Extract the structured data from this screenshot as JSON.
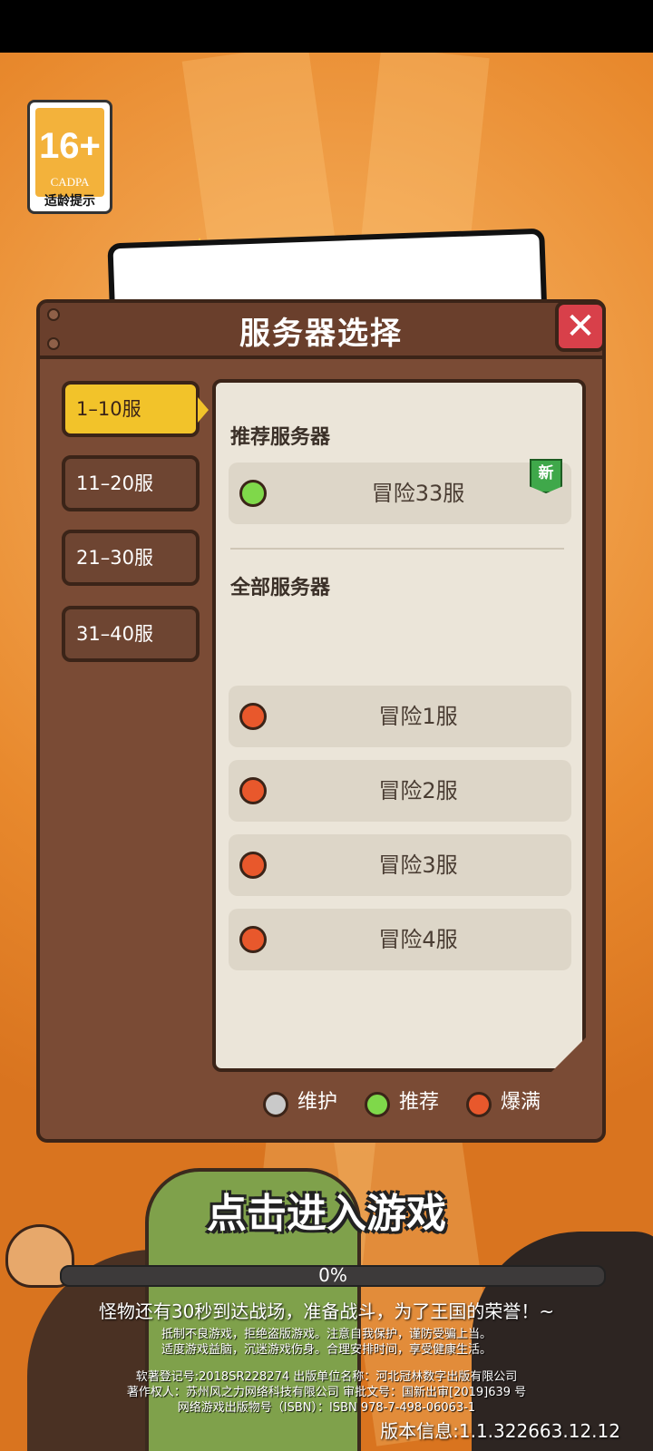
{
  "age_rating": {
    "number": "16+",
    "org": "CADPA",
    "label": "适龄提示"
  },
  "dialog": {
    "title": "服务器选择",
    "close_icon": "close-icon"
  },
  "tabs": [
    {
      "label": "1–10服",
      "active": true
    },
    {
      "label": "11–20服",
      "active": false
    },
    {
      "label": "21–30服",
      "active": false
    },
    {
      "label": "31–40服",
      "active": false
    }
  ],
  "recommended": {
    "title": "推荐服务器",
    "server": {
      "name": "冒险33服",
      "status": "recommended",
      "tag": "新"
    }
  },
  "all_servers": {
    "title": "全部服务器",
    "items": [
      {
        "name": "冒险1服",
        "status": "full"
      },
      {
        "name": "冒险2服",
        "status": "full"
      },
      {
        "name": "冒险3服",
        "status": "full"
      },
      {
        "name": "冒险4服",
        "status": "full"
      }
    ]
  },
  "legend": [
    {
      "label": "维护",
      "color": "#c9c9c9"
    },
    {
      "label": "推荐",
      "color": "#7fd84a"
    },
    {
      "label": "爆满",
      "color": "#e8582c"
    }
  ],
  "colors": {
    "maintenance": "#c9c9c9",
    "recommended": "#7fd84a",
    "full": "#e8582c",
    "panel_brown": "#7a4b35",
    "active_tab": "#f2c32a",
    "close_red": "#d8404a"
  },
  "bottom": {
    "enter_game": "点击进入游戏",
    "progress_text": "0%",
    "progress_value": 0,
    "hint": "怪物还有30秒到达战场，准备战斗，为了王国的荣誉！~",
    "notice_line1": "抵制不良游戏，拒绝盗版游戏。注意自我保护，谨防受骗上当。",
    "notice_line2": "适度游戏益脑，沉迷游戏伤身。合理安排时间，享受健康生活。",
    "credit_line1": "软著登记号:2018SR228274 出版单位名称：河北冠林数字出版有限公司",
    "credit_line2": "著作权人：苏州风之力网络科技有限公司 审批文号：国新出审[2019]639 号",
    "credit_line3": "网络游戏出版物号（ISBN）：ISBN 978-7-498-06063-1",
    "version": "版本信息:1.1.322663.12.12"
  }
}
